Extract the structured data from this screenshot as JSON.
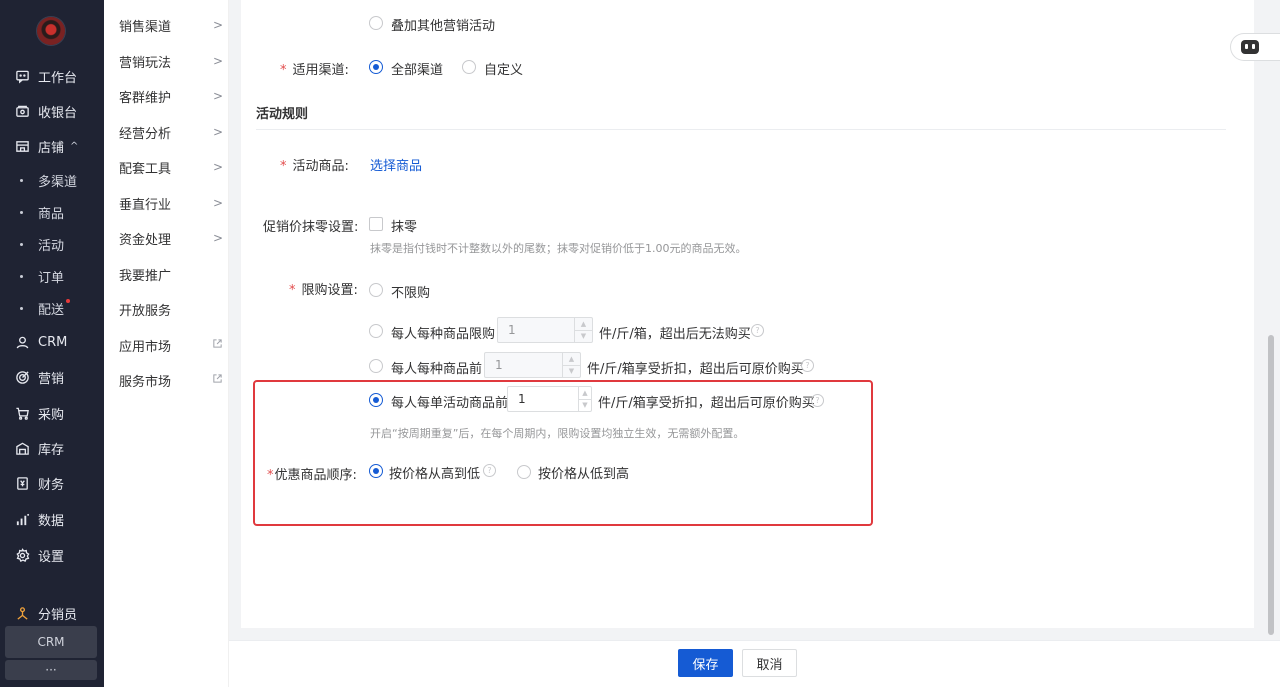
{
  "sidebar": {
    "items": [
      {
        "label": "工作台",
        "icon": "chat-icon"
      },
      {
        "label": "收银台",
        "icon": "cashier-icon"
      },
      {
        "label": "店铺",
        "icon": "store-icon"
      },
      {
        "label": "CRM",
        "icon": "user-icon"
      },
      {
        "label": "营销",
        "icon": "target-icon"
      },
      {
        "label": "采购",
        "icon": "cart-icon"
      },
      {
        "label": "库存",
        "icon": "warehouse-icon"
      },
      {
        "label": "财务",
        "icon": "finance-icon"
      },
      {
        "label": "数据",
        "icon": "bar-chart-icon"
      },
      {
        "label": "设置",
        "icon": "gear-icon"
      },
      {
        "label": "分销员",
        "icon": "distributor-icon"
      }
    ],
    "store_caret": "^",
    "store_subitems": [
      "多渠道",
      "商品",
      "活动",
      "订单",
      "配送"
    ],
    "crm_tag": "CRM",
    "more_tag": "···"
  },
  "subnav": {
    "items": [
      "销售渠道",
      "营销玩法",
      "客群维护",
      "经营分析",
      "配套工具",
      "垂直行业",
      "资金处理",
      "我要推广",
      "开放服务",
      "应用市场",
      "服务市场"
    ]
  },
  "form": {
    "stack_option": "叠加其他营销活动",
    "channel_label": "适用渠道:",
    "channel_all": "全部渠道",
    "channel_custom": "自定义",
    "section_title": "活动规则",
    "goods_label": "活动商品:",
    "goods_link": "选择商品",
    "round_label": "促销价抹零设置:",
    "round_option": "抹零",
    "round_hint": "抹零是指付钱时不计整数以外的尾数；抹零对促销价低于1.00元的商品无效。",
    "limit_label": "限购设置:",
    "limit_none": "不限购",
    "limit_opt1": "每人每种商品限购",
    "limit_opt1_value": "1",
    "limit_opt1_suffix": "件/斤/箱，超出后无法购买",
    "limit_opt2": "每人每种商品前",
    "limit_opt2_value": "1",
    "limit_opt2_suffix": "件/斤/箱享受折扣，超出后可原价购买",
    "limit_opt3": "每人每单活动商品前",
    "limit_opt3_value": "1",
    "limit_opt3_suffix": "件/斤/箱享受折扣，超出后可原价购买",
    "limit_hint": "开启“按周期重复”后，在每个周期内，限购设置均独立生效，无需额外配置。",
    "order_label": "优惠商品顺序:",
    "order_high": "按价格从高到低",
    "order_low": "按价格从低到高",
    "help_glyph": "?",
    "required_mark": "*"
  },
  "footer": {
    "save_label": "保存",
    "cancel_label": "取消"
  },
  "colors": {
    "primary": "#155bd4",
    "sidebar_bg": "#1f2333",
    "highlight_border": "#e0393e",
    "required": "#e24c4c"
  }
}
